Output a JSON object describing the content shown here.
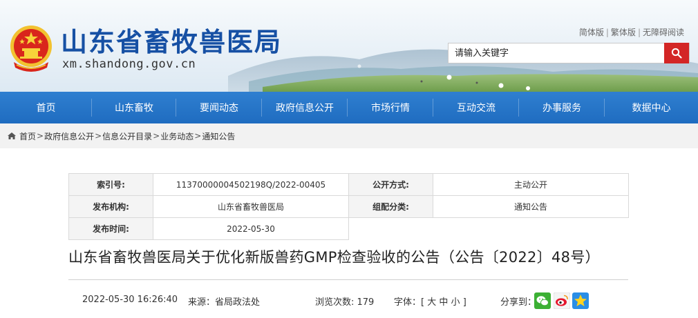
{
  "header": {
    "site_title": "山东省畜牧兽医局",
    "site_url": "xm.shandong.gov.cn",
    "links": {
      "simplified": "简体版",
      "traditional": "繁体版",
      "accessible": "无障碍阅读"
    },
    "separator": "|",
    "search": {
      "placeholder": "请输入关键字",
      "value": ""
    }
  },
  "nav": {
    "items": [
      {
        "label": "首页"
      },
      {
        "label": "山东畜牧"
      },
      {
        "label": "要闻动态"
      },
      {
        "label": "政府信息公开"
      },
      {
        "label": "市场行情"
      },
      {
        "label": "互动交流"
      },
      {
        "label": "办事服务"
      },
      {
        "label": "数据中心"
      }
    ]
  },
  "breadcrumb": {
    "items": [
      "首页",
      "政府信息公开",
      "信息公开目录",
      "业务动态",
      "通知公告"
    ],
    "separator": ">"
  },
  "info": {
    "index_label": "索引号:",
    "index_value": "11370000004502198Q/2022-00405",
    "open_label": "公开方式:",
    "open_value": "主动公开",
    "publisher_label": "发布机构:",
    "publisher_value": "山东省畜牧兽医局",
    "category_label": "组配分类:",
    "category_value": "通知公告",
    "date_label": "发布时间:",
    "date_value": "2022-05-30"
  },
  "article": {
    "title": "山东省畜牧兽医局关于优化新版兽药GMP检查验收的公告（公告〔2022〕48号）",
    "datetime": "2022-05-30 16:26:40",
    "source": "来源：省局政法处",
    "views": "浏览次数: 179",
    "font_label": "字体：[",
    "font_large": "大",
    "font_medium": "中",
    "font_small": "小",
    "font_close": "]",
    "share_label": "分享到："
  },
  "colors": {
    "nav_blue": "#1f6cc0",
    "title_blue": "#1650a4",
    "search_red": "#d32626"
  }
}
